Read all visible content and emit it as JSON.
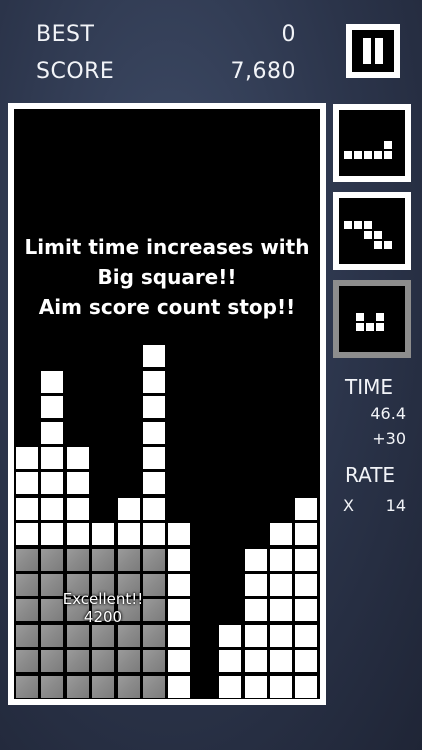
{
  "hud": {
    "best_label": "BEST",
    "best_value": "0",
    "score_label": "SCORE",
    "score_value": "7,680"
  },
  "board": {
    "message_lines": [
      "Limit time increases with",
      "Big square!!",
      "Aim score count stop!!"
    ],
    "bonus_text": "Excellent!!",
    "bonus_points": "4200"
  },
  "side": {
    "time_label": "TIME",
    "time_value": "46.4",
    "time_bonus": "+30",
    "rate_label": "RATE",
    "rate_prefix": "X",
    "rate_value": "14"
  },
  "colors": {
    "background": "#2b344a",
    "block": "#ffffff",
    "cleared_block": "#8a8a8a",
    "board": "#000000",
    "active_frame": "#8d8d8d"
  }
}
